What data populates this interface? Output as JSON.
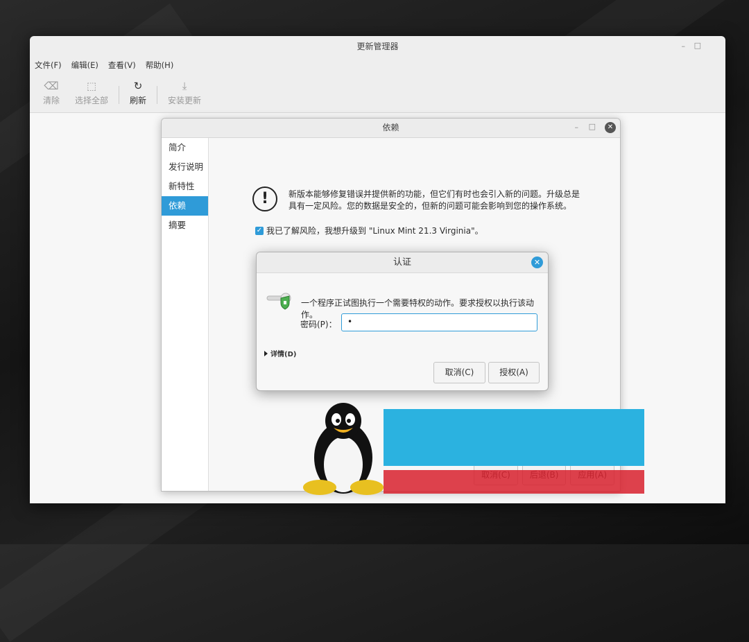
{
  "main_window": {
    "title": "更新管理器",
    "minimize": "–",
    "maximize": "□",
    "menu": [
      "文件(F)",
      "编辑(E)",
      "查看(V)",
      "帮助(H)"
    ],
    "toolbar": {
      "clear": {
        "icon": "backspace-icon",
        "label": "清除"
      },
      "select_all": {
        "icon": "select-all-icon",
        "label": "选择全部"
      },
      "refresh": {
        "icon": "refresh-icon",
        "label": "刷新"
      },
      "install": {
        "icon": "download-icon",
        "label": "安装更新"
      }
    }
  },
  "dependency_dialog": {
    "title": "依赖",
    "minimize": "–",
    "maximize": "□",
    "close": "✕",
    "sidebar": [
      {
        "label": "简介",
        "active": false
      },
      {
        "label": "发行说明",
        "active": false
      },
      {
        "label": "新特性",
        "active": false
      },
      {
        "label": "依赖",
        "active": true
      },
      {
        "label": "摘要",
        "active": false
      }
    ],
    "warning_icon": "!",
    "warning_text": "新版本能够修复错误并提供新的功能，但它们有时也会引入新的问题。升级总是具有一定风险。您的数据是安全的，但新的问题可能会影响到您的操作系统。",
    "agree_label": "我已了解风险，我想升级到 \"Linux Mint 21.3 Virginia\"。",
    "agree_checked": true,
    "buttons": {
      "cancel": "取消(C)",
      "back": "后退(B)",
      "apply": "应用(A)"
    }
  },
  "auth_dialog": {
    "title": "认证",
    "close": "✕",
    "message": "一个程序正试图执行一个需要特权的动作。要求授权以执行该动作。",
    "password_label": "密码(P)：",
    "password_value": "•",
    "details_label": "详情(D)",
    "cancel": "取消(C)",
    "authorize": "授权(A)"
  },
  "colors": {
    "accent": "#2f9bd8",
    "watermark_blue": "#2bb2e0",
    "watermark_red": "#d8212e"
  }
}
